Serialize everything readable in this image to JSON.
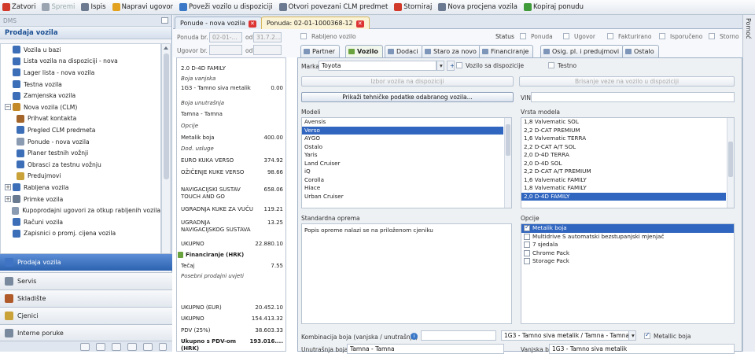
{
  "toolbar": {
    "items": [
      {
        "label": "Zatvori",
        "color": "#d13a2a",
        "enabled": true
      },
      {
        "label": "Spremi",
        "color": "#9aa4b1",
        "enabled": false
      },
      {
        "label": "Ispis",
        "color": "#6b7a90",
        "enabled": true
      },
      {
        "label": "Napravi ugovor",
        "color": "#e2a21f",
        "enabled": true
      },
      {
        "label": "Poveži vozilo u dispoziciji",
        "color": "#3a78c7",
        "enabled": true
      },
      {
        "label": "Otvori povezani CLM predmet",
        "color": "#6b7a90",
        "enabled": true
      },
      {
        "label": "Storniraj",
        "color": "#d13a2a",
        "enabled": true
      },
      {
        "label": "Nova procjena vozila",
        "color": "#6b7a90",
        "enabled": true
      },
      {
        "label": "Kopiraj ponudu",
        "color": "#3f9a3a",
        "enabled": true
      }
    ]
  },
  "right_strip": {
    "label": "Pomoć"
  },
  "sidebar": {
    "header": "DMS",
    "title": "Prodaja vozila",
    "tree": [
      {
        "label": "Vozila u bazi",
        "level": 0,
        "expander": ""
      },
      {
        "label": "Lista vozila na dispoziciji - nova",
        "level": 0,
        "expander": ""
      },
      {
        "label": "Lager lista - nova vozila",
        "level": 0,
        "expander": ""
      },
      {
        "label": "Testna vozila",
        "level": 0,
        "expander": ""
      },
      {
        "label": "Zamjenska vozila",
        "level": 0,
        "expander": ""
      },
      {
        "label": "Nova vozila (CLM)",
        "level": 0,
        "expander": "−"
      },
      {
        "label": "Prihvat kontakta",
        "level": 1,
        "expander": ""
      },
      {
        "label": "Pregled CLM predmeta",
        "level": 1,
        "expander": ""
      },
      {
        "label": "Ponude - nova vozila",
        "level": 1,
        "expander": ""
      },
      {
        "label": "Planer testnih vožnji",
        "level": 1,
        "expander": ""
      },
      {
        "label": "Obrasci za testnu vožnju",
        "level": 1,
        "expander": ""
      },
      {
        "label": "Predujmovi",
        "level": 1,
        "expander": ""
      },
      {
        "label": "Rabljena vozila",
        "level": 0,
        "expander": "+"
      },
      {
        "label": "Primke vozila",
        "level": 0,
        "expander": "+"
      },
      {
        "label": "Kupoprodajni ugovori za otkup rabljenih vozila",
        "level": 0,
        "expander": ""
      },
      {
        "label": "Računi vozila",
        "level": 0,
        "expander": ""
      },
      {
        "label": "Zapisnici o promj. cijena vozila",
        "level": 0,
        "expander": ""
      }
    ],
    "nav_buttons": [
      {
        "label": "Prodaja vozila",
        "active": true,
        "color": "#3f73c4"
      },
      {
        "label": "Servis",
        "active": false,
        "color": "#7a8a9e"
      },
      {
        "label": "Skladište",
        "active": false,
        "color": "#b05a2a"
      },
      {
        "label": "Cjenici",
        "active": false,
        "color": "#caa23a"
      },
      {
        "label": "Interne poruke",
        "active": false,
        "color": "#7a8a9e"
      }
    ]
  },
  "doc_tabs": [
    {
      "label": "Ponude - nova vozila",
      "active": false
    },
    {
      "label": "Ponuda: 02-01-1000368-12",
      "active": true
    }
  ],
  "header": {
    "ponuda_br_label": "Ponuda br.",
    "ponuda_br_value": "02-01-...",
    "od_label": "od",
    "od_value": "31.7.2...",
    "ugovor_br_label": "Ugovor br.",
    "ugovor_od_label": "od",
    "rabljeno_label": "Rabljeno vozilo",
    "status_label": "Status",
    "status_items": [
      "Ponuda",
      "Ugovor",
      "Fakturirano",
      "Isporučeno",
      "Storno"
    ]
  },
  "offer_lines": [
    {
      "text": "2.0 D-4D FAMILY",
      "value": "",
      "style": "normal"
    },
    {
      "text": "Boja vanjska",
      "value": "",
      "style": "italic"
    },
    {
      "text": "1G3 - Tamno siva metalik",
      "value": "0.00",
      "style": "normal"
    },
    {
      "text": "Boja unutrašnja",
      "value": "",
      "style": "italic"
    },
    {
      "text": "Tamna - Tamna",
      "value": "",
      "style": "normal"
    },
    {
      "text": "Opcije",
      "value": "",
      "style": "italic"
    },
    {
      "text": "Metalik boja",
      "value": "400.00",
      "style": "normal"
    },
    {
      "text": "Dod. usluge",
      "value": "",
      "style": "italic"
    },
    {
      "text": "EURO KUKA VERSO",
      "value": "374.92",
      "style": "normal"
    },
    {
      "text": "OŽIČENJE KUKE VERSO",
      "value": "98.66",
      "style": "normal"
    },
    {
      "text": "NAVIGACIJSKI SUSTAV TOUCH AND GO",
      "value": "658.06",
      "style": "normal"
    },
    {
      "text": "UGRADNJA KUKE ZA VUČU",
      "value": "119.21",
      "style": "normal"
    },
    {
      "text": "UGRADNJA NAVIGACIJSKOG SUSTAVA",
      "value": "13.25",
      "style": "normal"
    },
    {
      "text": "UKUPNO",
      "value": "22.880.10",
      "style": "normal"
    },
    {
      "text": "Financiranje (HRK)",
      "value": "",
      "style": "bold"
    },
    {
      "text": "Tečaj",
      "value": "7.55",
      "style": "normal"
    },
    {
      "text": "Posebni prodajni uvjeti",
      "value": "",
      "style": "italic"
    },
    {
      "text": "UKUPNO (EUR)",
      "value": "20.452.10",
      "style": "normal"
    },
    {
      "text": "UKUPNO",
      "value": "154.413.32",
      "style": "normal"
    },
    {
      "text": "PDV (25%)",
      "value": "38.603.33",
      "style": "normal"
    },
    {
      "text": "Ukupno s PDV-om (HRK)",
      "value": "193.016....",
      "style": "bold"
    }
  ],
  "sub_tabs": [
    {
      "label": "Partner",
      "active": false
    },
    {
      "label": "Vozilo",
      "active": true
    },
    {
      "label": "Dodaci",
      "active": false
    },
    {
      "label": "Staro za novo",
      "active": false
    },
    {
      "label": "Financiranje",
      "active": false
    },
    {
      "label": "Osig. pl. i predujmovi",
      "active": false
    },
    {
      "label": "Ostalo",
      "active": false
    }
  ],
  "vehicle": {
    "marka_label": "Marka",
    "marka_value": "Toyota",
    "vozilo_dispozicija_label": "Vozilo sa dispozicije",
    "testno_label": "Testno",
    "btn_izbor": "Izbor vozila na dispoziciji",
    "btn_brisanje": "Brisanje veze na vozilo u dispoziciji",
    "btn_tehnicki": "Prikaži tehničke podatke odabranog vozila...",
    "vin_label": "VIN",
    "modeli_label": "Modeli",
    "modeli": [
      "Avensis",
      "Verso",
      "AYGO",
      "Ostalo",
      "Yaris",
      "Land Cruiser",
      "iQ",
      "Corolla",
      "Hiace",
      "Urban Cruiser"
    ],
    "modeli_selected": 1,
    "vrsta_label": "Vrsta modela",
    "vrste": [
      "1,8 Valvematic SOL",
      "2,2 D-CAT PREMIUM",
      "1,6 Valvematic TERRA",
      "2,2 D-CAT A/T SOL",
      "2,0 D-4D TERRA",
      "2,0 D-4D SOL",
      "2,2 D-CAT A/T PREMIUM",
      "1,6 Valvematic FAMILY",
      "1,8 Valvematic FAMILY",
      "2,0 D-4D FAMILY"
    ],
    "vrste_selected": 9,
    "standard_label": "Standardna oprema",
    "standard_text": "Popis opreme nalazi se na priloženom cjeniku",
    "opcije_label": "Opcije",
    "opcije": [
      {
        "label": "Metalik boja",
        "checked": true
      },
      {
        "label": "Multidrive S automatski bezstupanjski mjenjač",
        "checked": false
      },
      {
        "label": "7 sjedala",
        "checked": false
      },
      {
        "label": "Chrome Pack",
        "checked": false
      },
      {
        "label": "Storage Pack",
        "checked": false
      }
    ],
    "kombinacija_label": "Kombinacija boja (vanjska / unutrašnja)",
    "kombinacija_value": "1G3 - Tamno siva metalik / Tamna - Tamna",
    "metalic_label": "Metallic boja",
    "unutrasnja_label": "Unutrašnja boja",
    "unutrasnja_value": "Tamna - Tamna",
    "vanjska_label": "Vanjska boja",
    "vanjska_value": "1G3 - Tamno siva metalik"
  }
}
